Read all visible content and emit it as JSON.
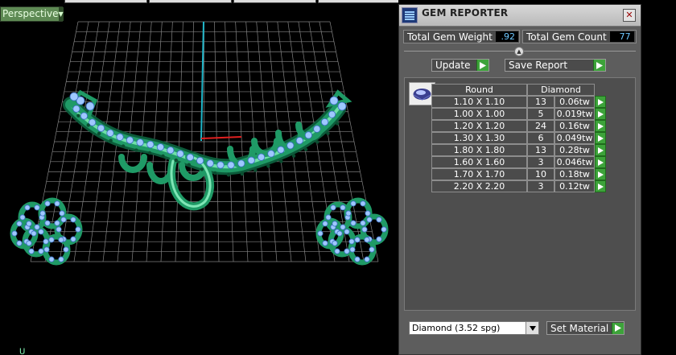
{
  "viewport": {
    "view_mode": "Perspective"
  },
  "panel": {
    "title": "GEM REPORTER",
    "close_glyph": "✕",
    "total_gem_weight_label": "Total Gem Weight",
    "total_gem_weight_value": ".92",
    "total_gem_count_label": "Total Gem Count",
    "total_gem_count_value": "77",
    "update_label": "Update",
    "save_report_label": "Save Report",
    "table": {
      "headers": [
        "Round",
        "Diamond"
      ],
      "rows": [
        {
          "size": "1.10 X 1.10",
          "count": "13",
          "weight": "0.06tw"
        },
        {
          "size": "1.00 X 1.00",
          "count": "5",
          "weight": "0.019tw"
        },
        {
          "size": "1.20 X 1.20",
          "count": "24",
          "weight": "0.16tw"
        },
        {
          "size": "1.30 X 1.30",
          "count": "6",
          "weight": "0.049tw"
        },
        {
          "size": "1.80 X 1.80",
          "count": "13",
          "weight": "0.28tw"
        },
        {
          "size": "1.60 X 1.60",
          "count": "3",
          "weight": "0.046tw"
        },
        {
          "size": "1.70 X 1.70",
          "count": "10",
          "weight": "0.18tw"
        },
        {
          "size": "2.20 X 2.20",
          "count": "3",
          "weight": "0.12tw"
        }
      ]
    },
    "material_select_value": "Diamond      (3.52 spg)",
    "set_material_label": "Set Material"
  },
  "colors": {
    "panel_bg": "#5d5d5d",
    "accent_green": "#3da33a",
    "value_text": "#6ec7ff",
    "jewelry_metal": "#1f9a66",
    "gem": "#9ec8ff"
  },
  "icons": {
    "app": "gem-reporter-app-icon",
    "close": "close-icon",
    "arrow": "play-arrow-icon",
    "dropdown": "chevron-down-icon",
    "gem": "round-diamond-icon"
  }
}
